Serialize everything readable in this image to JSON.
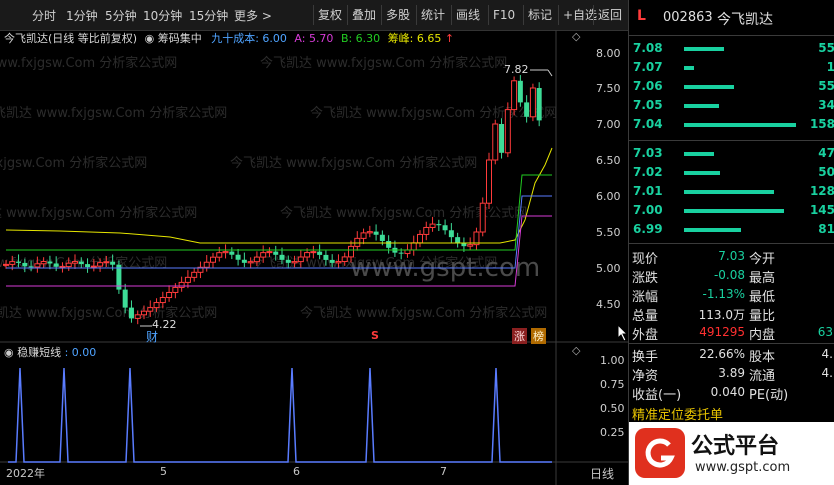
{
  "toolbar": {
    "left_items": [
      "分时",
      "1分钟",
      "5分钟",
      "10分钟",
      "15分钟",
      "更多 >"
    ],
    "right_items": [
      "复权",
      "叠加",
      "多股",
      "统计",
      "画线",
      "F10",
      "标记",
      "+自选",
      "返回"
    ]
  },
  "chart_header": {
    "stock": "今飞凯达(日线 等比前复权)",
    "indicator": "筹码集中",
    "cost90_label": "九十成本: 6.00",
    "a_label": "A: 5.70",
    "b_label": "B: 6.30",
    "peak_label": "筹峰: 6.65",
    "peak_arrow": "↑",
    "diamond": "◇"
  },
  "watermark": "今飞凯达 www.fxjgsw.Com 分析家公式网",
  "site_watermark": "www.gspt.com",
  "price_axis": [
    "8.00",
    "7.50",
    "7.00",
    "6.50",
    "6.00",
    "5.50",
    "5.00",
    "4.50"
  ],
  "chart_annotations": {
    "high": "7.82",
    "low": "4.22",
    "cai": "财",
    "s": "S",
    "zhang": "涨",
    "bang": "榜"
  },
  "sub_header": {
    "name": "稳赚短线",
    "value": ": 0.00"
  },
  "sub_axis": [
    "1.00",
    "0.75",
    "0.50",
    "0.25"
  ],
  "time_axis": [
    "2022年",
    "5",
    "6",
    "7"
  ],
  "period_label": "日线",
  "right_panel": {
    "code": "002863",
    "name": "今飞凯达",
    "l_badge": "L",
    "asks": [
      {
        "price": "7.08",
        "vol": "55"
      },
      {
        "price": "7.07",
        "vol": "1"
      },
      {
        "price": "7.06",
        "vol": "55"
      },
      {
        "price": "7.05",
        "vol": "34"
      },
      {
        "price": "7.04",
        "vol": "158"
      }
    ],
    "bids": [
      {
        "price": "7.03",
        "vol": "47"
      },
      {
        "price": "7.02",
        "vol": "50"
      },
      {
        "price": "7.01",
        "vol": "128"
      },
      {
        "price": "7.00",
        "vol": "145"
      },
      {
        "price": "6.99",
        "vol": "81"
      }
    ],
    "stats": [
      {
        "l1": "现价",
        "v1": "7.03",
        "l2": "今开",
        "v2": "",
        "c1": "#19d1a0"
      },
      {
        "l1": "涨跌",
        "v1": "-0.08",
        "l2": "最高",
        "v2": "",
        "c1": "#19d1a0"
      },
      {
        "l1": "涨幅",
        "v1": "-1.13%",
        "l2": "最低",
        "v2": "",
        "c1": "#19d1a0"
      },
      {
        "l1": "总量",
        "v1": "113.0万",
        "l2": "量比",
        "v2": "",
        "c1": "#e0e0e0"
      },
      {
        "l1": "外盘",
        "v1": "491295",
        "l2": "内盘",
        "v2": "63",
        "c1": "#ff3030"
      },
      {
        "l1": "换手",
        "v1": "22.66%",
        "l2": "股本",
        "v2": "4.",
        "c1": "#e0e0e0"
      },
      {
        "l1": "净资",
        "v1": "3.89",
        "l2": "流通",
        "v2": "4.",
        "c1": "#e0e0e0"
      },
      {
        "l1": "收益(一)",
        "v1": "0.040",
        "l2": "PE(动)",
        "v2": "",
        "c1": "#e0e0e0"
      }
    ],
    "promo": "精准定位委托单",
    "logo_text": "公式平台",
    "logo_url": "www.gspt.com"
  },
  "colors": {
    "up": "#ff3b3b",
    "down": "#3ddc97",
    "ma_yellow": "#e6e600",
    "line_green": "#22cc22",
    "line_blue": "#5a7cff",
    "line_magenta": "#d63bd6",
    "sub_line": "#4a6cff"
  }
}
